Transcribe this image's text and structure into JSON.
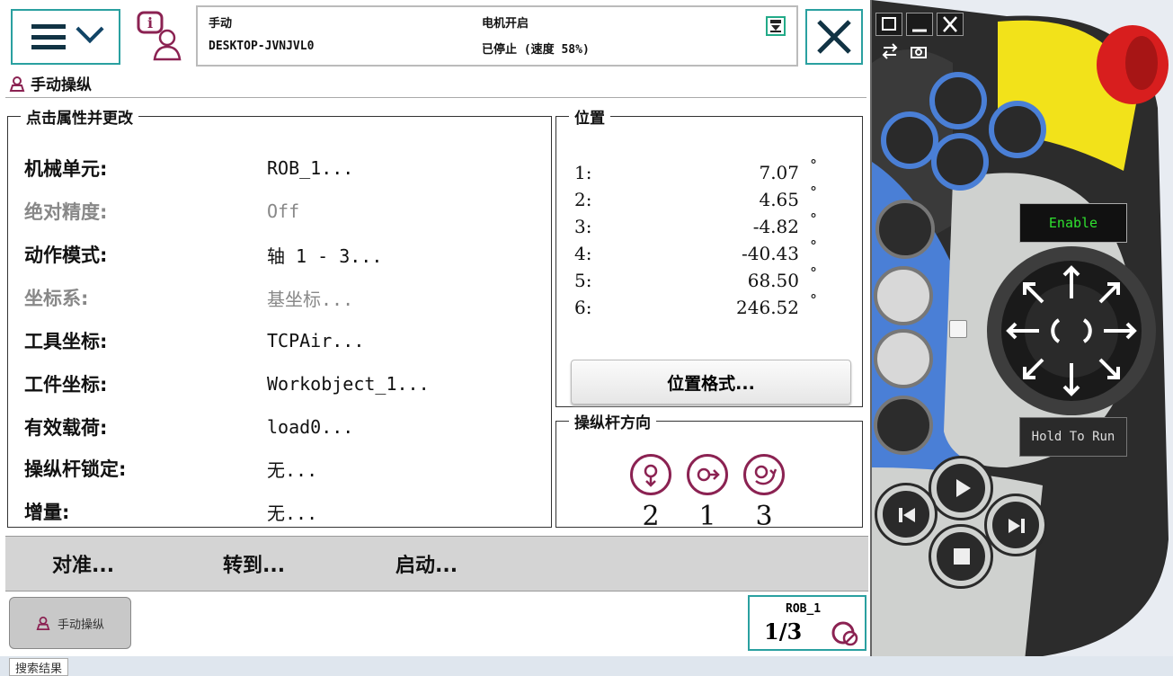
{
  "header": {
    "mode": "手动",
    "controller": "DESKTOP-JVNJVL0",
    "motor_state": "电机开启",
    "run_state": "已停止 (速度 58%)"
  },
  "app": {
    "title": "手动操纵"
  },
  "properties": {
    "legend": "点击属性并更改",
    "rows": [
      {
        "label": "机械单元:",
        "value": "ROB_1...",
        "enabled": true
      },
      {
        "label": "绝对精度:",
        "value": "Off",
        "enabled": false
      },
      {
        "label": "动作模式:",
        "value": "轴 1 - 3...",
        "enabled": true
      },
      {
        "label": "坐标系:",
        "value": "基坐标...",
        "enabled": false
      },
      {
        "label": "工具坐标:",
        "value": "TCPAir...",
        "enabled": true
      },
      {
        "label": "工件坐标:",
        "value": "Workobject_1...",
        "enabled": true
      },
      {
        "label": "有效载荷:",
        "value": "load0...",
        "enabled": true
      },
      {
        "label": "操纵杆锁定:",
        "value": "无...",
        "enabled": true
      },
      {
        "label": "增量:",
        "value": "无...",
        "enabled": true
      }
    ]
  },
  "position": {
    "legend": "位置",
    "rows": [
      {
        "axis": "1:",
        "value": "7.07",
        "unit": "°"
      },
      {
        "axis": "2:",
        "value": "4.65",
        "unit": "°"
      },
      {
        "axis": "3:",
        "value": "-4.82",
        "unit": "°"
      },
      {
        "axis": "4:",
        "value": "-40.43",
        "unit": "°"
      },
      {
        "axis": "5:",
        "value": "68.50",
        "unit": "°"
      },
      {
        "axis": "6:",
        "value": "246.52",
        "unit": "°"
      }
    ],
    "format_button": "位置格式..."
  },
  "joystick_direction": {
    "legend": "操纵杆方向",
    "numbers": [
      "2",
      "1",
      "3"
    ]
  },
  "commands": [
    "对准...",
    "转到...",
    "启动..."
  ],
  "taskbar": {
    "task_label": "手动操纵",
    "quickset_unit": "ROB_1",
    "quickset_fraction": "1/3"
  },
  "pendant": {
    "enable_label": "Enable",
    "hold_label": "Hold To Run",
    "colors": {
      "body": "#3b3b3b",
      "accent": "#4a7fd6",
      "stop": "#d81e1e",
      "enable_housing": "#f2e21a"
    }
  },
  "bottom_label": "搜索结果"
}
